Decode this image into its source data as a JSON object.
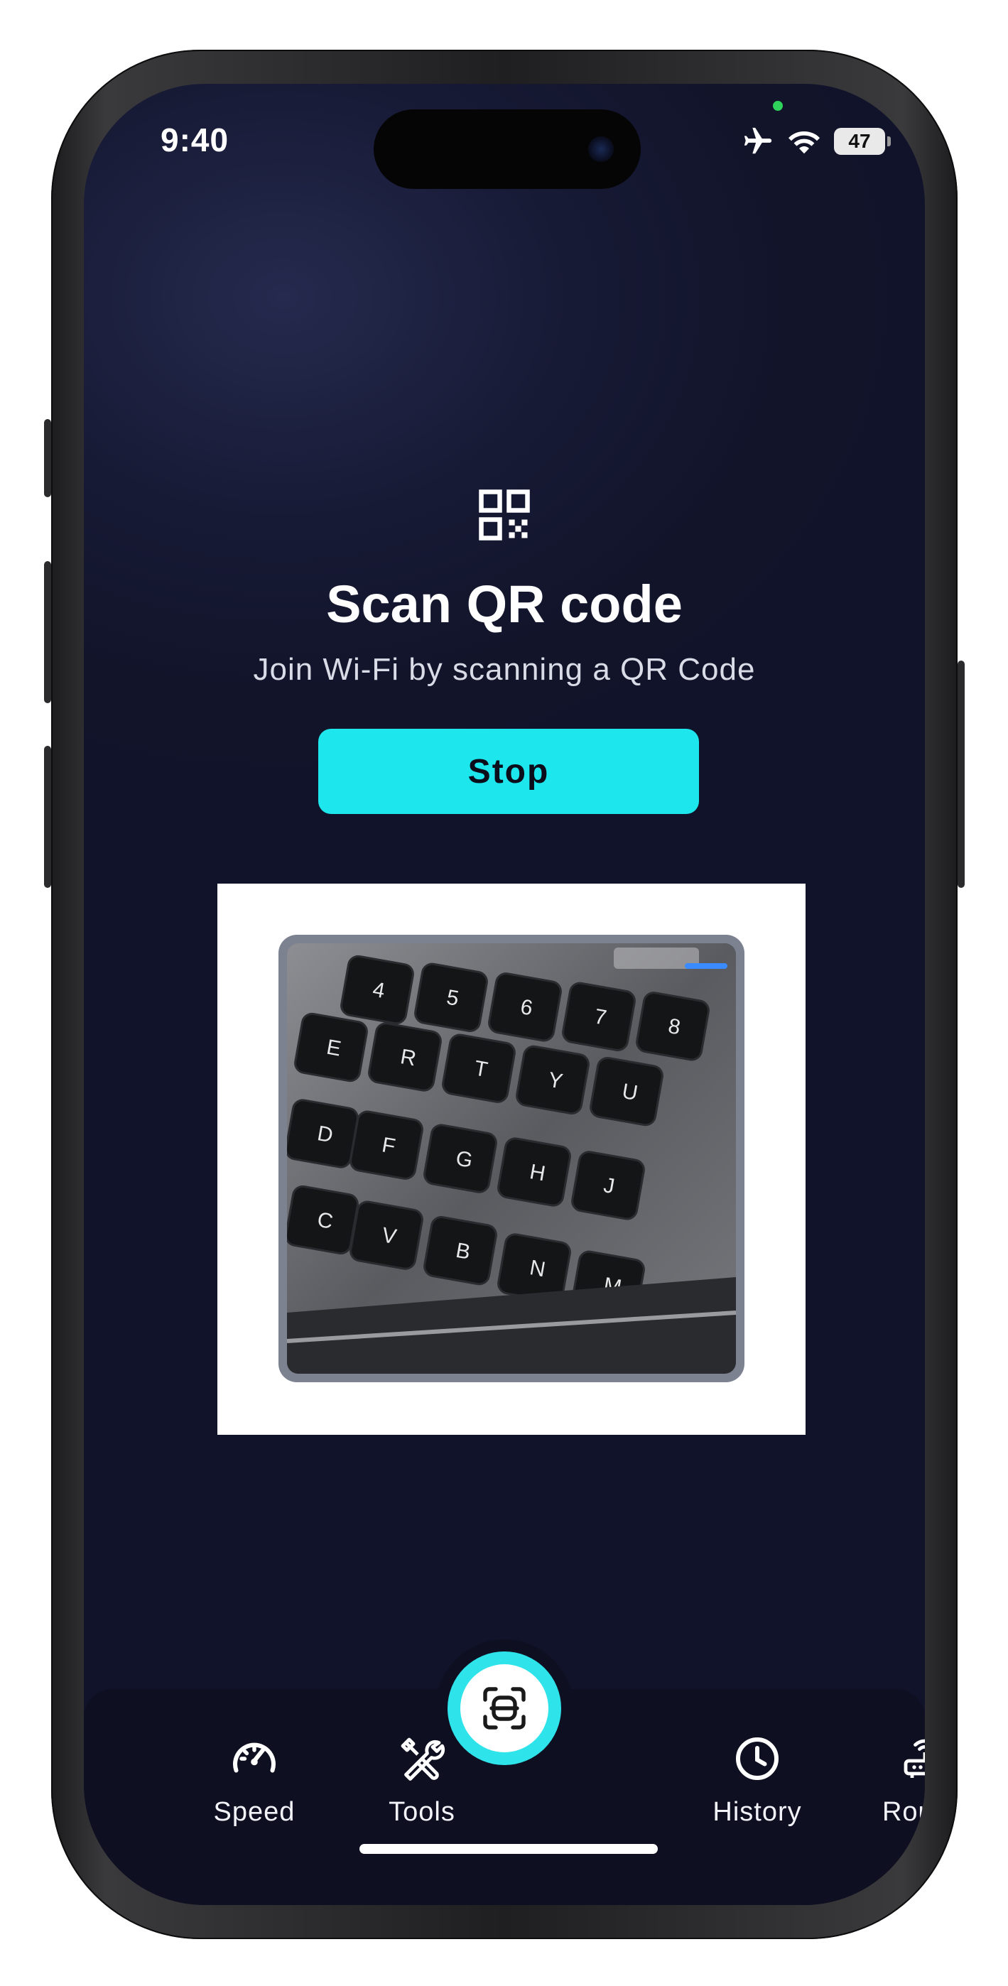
{
  "status_bar": {
    "time": "9:40",
    "battery": "47",
    "icons": [
      "airplane-icon",
      "wifi-icon",
      "battery-icon"
    ]
  },
  "scanner": {
    "icon": "qr-code-icon",
    "title": "Scan QR code",
    "subtitle": "Join Wi-Fi by scanning a QR Code",
    "stop_label": "Stop"
  },
  "camera_preview": {
    "keys": [
      "4",
      "5",
      "6",
      "7",
      "8",
      "E",
      "R",
      "T",
      "Y",
      "U",
      "D",
      "F",
      "G",
      "H",
      "J",
      "C",
      "V",
      "B",
      "N",
      "M"
    ]
  },
  "tab_bar": {
    "tabs": [
      {
        "label": "Speed",
        "icon": "speedometer-icon"
      },
      {
        "label": "Tools",
        "icon": "tools-icon"
      },
      {
        "label": "History",
        "icon": "clock-icon"
      },
      {
        "label": "Router",
        "icon": "router-icon"
      }
    ],
    "center_button_icon": "scan-icon"
  },
  "colors": {
    "accent": "#1de6ec",
    "background": "#12142a",
    "tab_bar": "#0e1022"
  }
}
